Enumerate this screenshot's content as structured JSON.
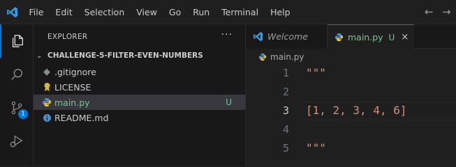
{
  "menu": [
    "File",
    "Edit",
    "Selection",
    "View",
    "Go",
    "Run",
    "Terminal",
    "Help"
  ],
  "nav": {
    "back": "←",
    "forward": "→"
  },
  "sidebar": {
    "title": "EXPLORER",
    "more": "···",
    "folder": "CHALLENGE-5-FILTER-EVEN-NUMBERS",
    "files": [
      {
        "name": ".gitignore",
        "icon": "gitignore-icon",
        "status": ""
      },
      {
        "name": "LICENSE",
        "icon": "license-icon",
        "status": ""
      },
      {
        "name": "main.py",
        "icon": "python-icon",
        "status": "U"
      },
      {
        "name": "README.md",
        "icon": "info-icon",
        "status": ""
      }
    ]
  },
  "activity": {
    "scm_badge": "1"
  },
  "editor": {
    "tabs": [
      {
        "label": "Welcome",
        "icon": "vscode-icon"
      },
      {
        "label": "main.py",
        "icon": "python-icon",
        "status": "U",
        "close": "×"
      }
    ],
    "breadcrumb": "main.py",
    "lines": [
      {
        "num": "1",
        "text": "\"\"\""
      },
      {
        "num": "2",
        "text": ""
      },
      {
        "num": "3",
        "text": "[1, 2, 3, 4, 6]"
      },
      {
        "num": "4",
        "text": ""
      },
      {
        "num": "5",
        "text": "\"\"\""
      }
    ]
  },
  "colors": {
    "accent": "#0078d4",
    "untracked": "#73c991",
    "string": "#ce9178"
  }
}
